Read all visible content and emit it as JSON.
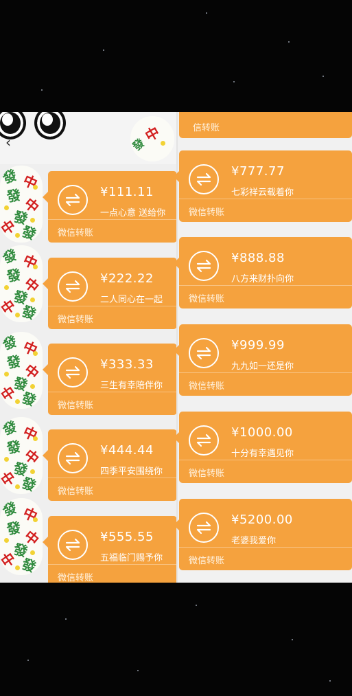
{
  "left_column": {
    "back_label": "‹",
    "transfers": [
      {
        "amount": "¥111.11",
        "note": "一点心意  送给你",
        "footer": "微信转账"
      },
      {
        "amount": "¥222.22",
        "note": "二人同心在一起",
        "footer": "微信转账"
      },
      {
        "amount": "¥333.33",
        "note": "三生有幸陪伴你",
        "footer": "微信转账"
      },
      {
        "amount": "¥444.44",
        "note": "四季平安围绕你",
        "footer": "微信转账"
      },
      {
        "amount": "¥555.55",
        "note": "五福临门赐予你",
        "footer": "微信转账"
      }
    ]
  },
  "right_column": {
    "top_footer": "信转账",
    "transfers": [
      {
        "amount": "¥777.77",
        "note": "七彩祥云载着你",
        "footer": "微信转账"
      },
      {
        "amount": "¥888.88",
        "note": "八方来财扑向你",
        "footer": "微信转账"
      },
      {
        "amount": "¥999.99",
        "note": "九九如一还是你",
        "footer": "微信转账"
      },
      {
        "amount": "¥1000.00",
        "note": "十分有幸遇见你",
        "footer": "微信转账"
      },
      {
        "amount": "¥5200.00",
        "note": "老婆我爱你",
        "footer": "微信转账"
      }
    ]
  },
  "avatar_tiles": {
    "fa": "發",
    "zhong": "中"
  },
  "colors": {
    "card": "#f5a23e",
    "background": "#050505"
  },
  "icons": {
    "transfer": "transfer-arrows-icon",
    "back": "chevron-left-icon"
  }
}
